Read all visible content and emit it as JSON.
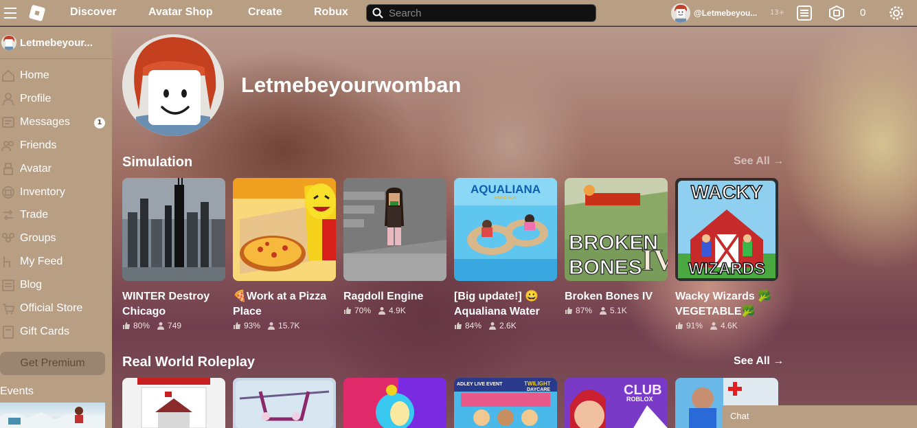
{
  "topbar": {
    "nav": [
      "Discover",
      "Avatar Shop",
      "Create",
      "Robux"
    ],
    "search_placeholder": "Search",
    "username": "@Letmebeyou...",
    "age": "13+",
    "robux": "0"
  },
  "sidebar": {
    "username": "Letmebeyour...",
    "items": [
      {
        "label": "Home",
        "icon": "home-icon"
      },
      {
        "label": "Profile",
        "icon": "profile-icon"
      },
      {
        "label": "Messages",
        "icon": "messages-icon",
        "badge": "1"
      },
      {
        "label": "Friends",
        "icon": "friends-icon"
      },
      {
        "label": "Avatar",
        "icon": "avatar-icon"
      },
      {
        "label": "Inventory",
        "icon": "inventory-icon"
      },
      {
        "label": "Trade",
        "icon": "trade-icon"
      },
      {
        "label": "Groups",
        "icon": "groups-icon"
      },
      {
        "label": "My Feed",
        "icon": "feed-icon"
      },
      {
        "label": "Blog",
        "icon": "blog-icon"
      },
      {
        "label": "Official Store",
        "icon": "store-icon"
      },
      {
        "label": "Gift Cards",
        "icon": "gift-card-icon"
      }
    ],
    "premium_label": "Get Premium",
    "events_label": "Events"
  },
  "profile": {
    "display_name": "Letmebeyourwomban"
  },
  "sections": [
    {
      "title": "Simulation",
      "see_all": "See All →",
      "games": [
        {
          "title": "WINTER Destroy Chicago",
          "rating": "80%",
          "players": "749"
        },
        {
          "title": "🍕Work at a Pizza Place",
          "rating": "93%",
          "players": "15.7K"
        },
        {
          "title": "Ragdoll Engine",
          "rating": "70%",
          "players": "4.9K"
        },
        {
          "title": "[Big update!] 😀 Aqualiana Water",
          "rating": "84%",
          "players": "2.6K"
        },
        {
          "title": "Broken Bones IV",
          "rating": "87%",
          "players": "5.1K"
        },
        {
          "title": "Wacky Wizards 🥦VEGETABLE🥦",
          "rating": "91%",
          "players": "4.6K"
        }
      ]
    },
    {
      "title": "Real World Roleplay",
      "see_all": "See All →"
    }
  ],
  "tile_text": {
    "aqualiana": "AQUALIANA",
    "aqualiana_sub": "WATER PARK",
    "broken": "BROKEN",
    "bones": "BONES",
    "bones_num": "IV",
    "wacky": "WACKY",
    "wizards": "WIZARDS",
    "adley": "ADLEY LIVE EVENT",
    "twilight": "TWILIGHT",
    "daycare": "DAYCARE",
    "club": "CLUB",
    "roblox": "ROBLOX"
  },
  "chat": {
    "label": "Chat"
  }
}
